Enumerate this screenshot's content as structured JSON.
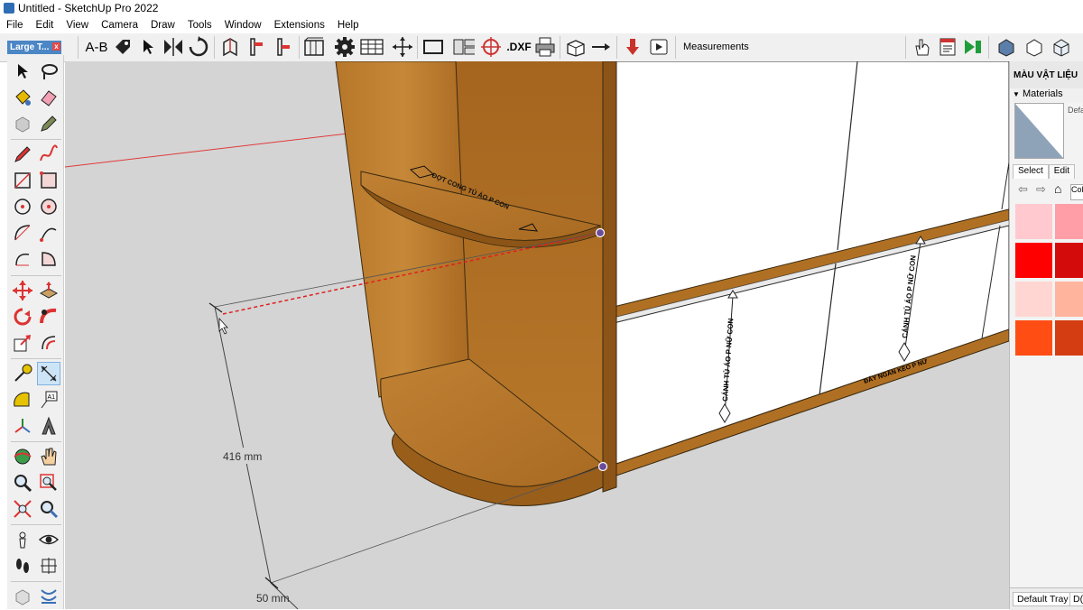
{
  "window": {
    "title": "Untitled - SketchUp Pro 2022"
  },
  "menu": [
    "File",
    "Edit",
    "View",
    "Camera",
    "Draw",
    "Tools",
    "Window",
    "Extensions",
    "Help"
  ],
  "toolbar": {
    "ab_label": "A-B",
    "dxf_label": ".DXF",
    "measurements_label": "Measurements"
  },
  "large_tool_set": {
    "title": "Large T...",
    "close": "x"
  },
  "tray": {
    "title": "MÀU VẬT LIỆU",
    "materials_label": "Materials",
    "default_text": "Defa",
    "tabs": [
      "Select",
      "Edit"
    ],
    "nav_text": "Col",
    "swatches": [
      "#ffc9cf",
      "#ff9ea7",
      "#ff0000",
      "#d40b0b",
      "#ffd6d1",
      "#ffb49e",
      "#ff4d14",
      "#d43d12"
    ],
    "bottom_tabs": [
      "Default Tray",
      "D("
    ]
  },
  "viewport": {
    "dim_height": "416 mm",
    "dim_depth": "50 mm",
    "shelf_text": "ĐỢT CONG TỦ ÁO P CON",
    "door_text_1": "CÁNH TỦ ÁO P NỮ CON",
    "door_text_2": "CÁNH TỦ ÁO P NỮ CON",
    "bottom_text": "ĐÁY NGĂN KÉO P NỮ",
    "colors": {
      "wood": "#b07024",
      "wood_dark": "#8c5417",
      "background": "#d4d4d4",
      "inference_line": "#e02020",
      "endpoint": "#6a4c9c"
    }
  }
}
